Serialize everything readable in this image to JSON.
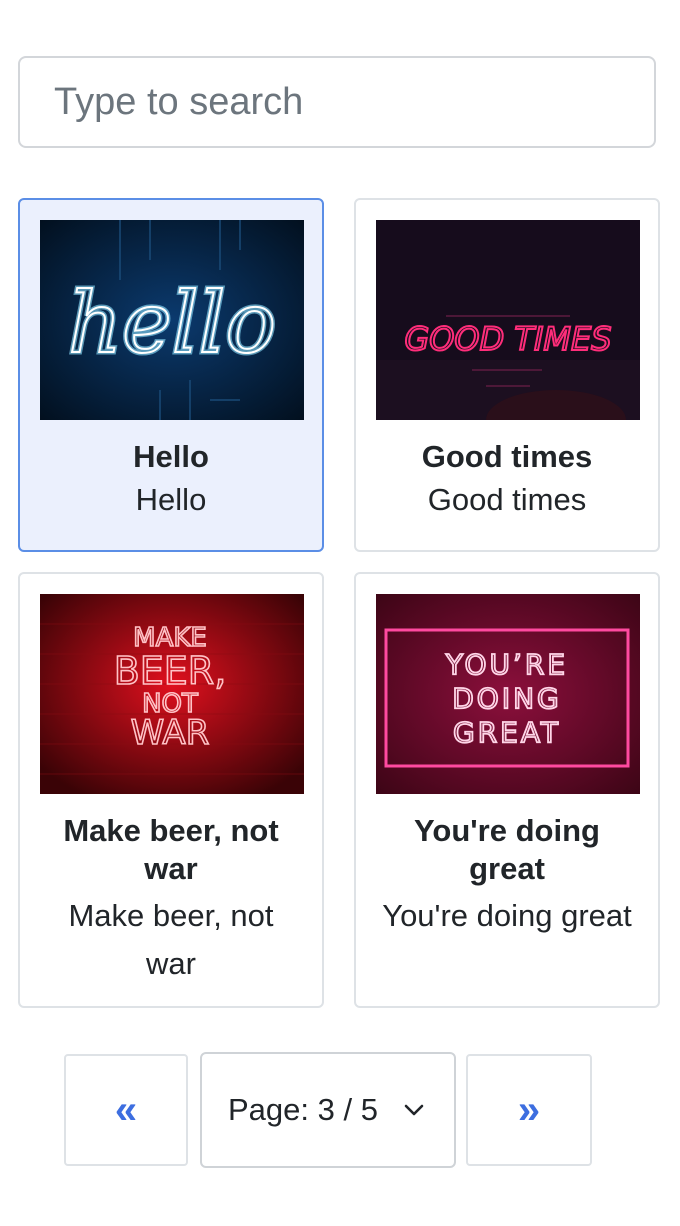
{
  "search": {
    "placeholder": "Type to search",
    "value": ""
  },
  "cards": [
    {
      "title": "Hello",
      "subtitle": "Hello",
      "selected": true,
      "image_text": "hello"
    },
    {
      "title": "Good times",
      "subtitle": "Good times",
      "selected": false,
      "image_text": "GOOD TIMES"
    },
    {
      "title": "Make beer, not war",
      "subtitle": "Make beer, not war",
      "selected": false,
      "image_text": "MAKE BEER, NOT WAR"
    },
    {
      "title": "You're doing great",
      "subtitle": "You're doing great",
      "selected": false,
      "image_text": "YOU'RE DOING GREAT"
    }
  ],
  "pagination": {
    "prev_label": "«",
    "next_label": "»",
    "page_label": "Page: 3 / 5",
    "current_page": 3,
    "total_pages": 5
  },
  "colors": {
    "accent": "#3d6ee0",
    "selected_bg": "#ebf0fd",
    "selected_border": "#5b8ee6"
  }
}
